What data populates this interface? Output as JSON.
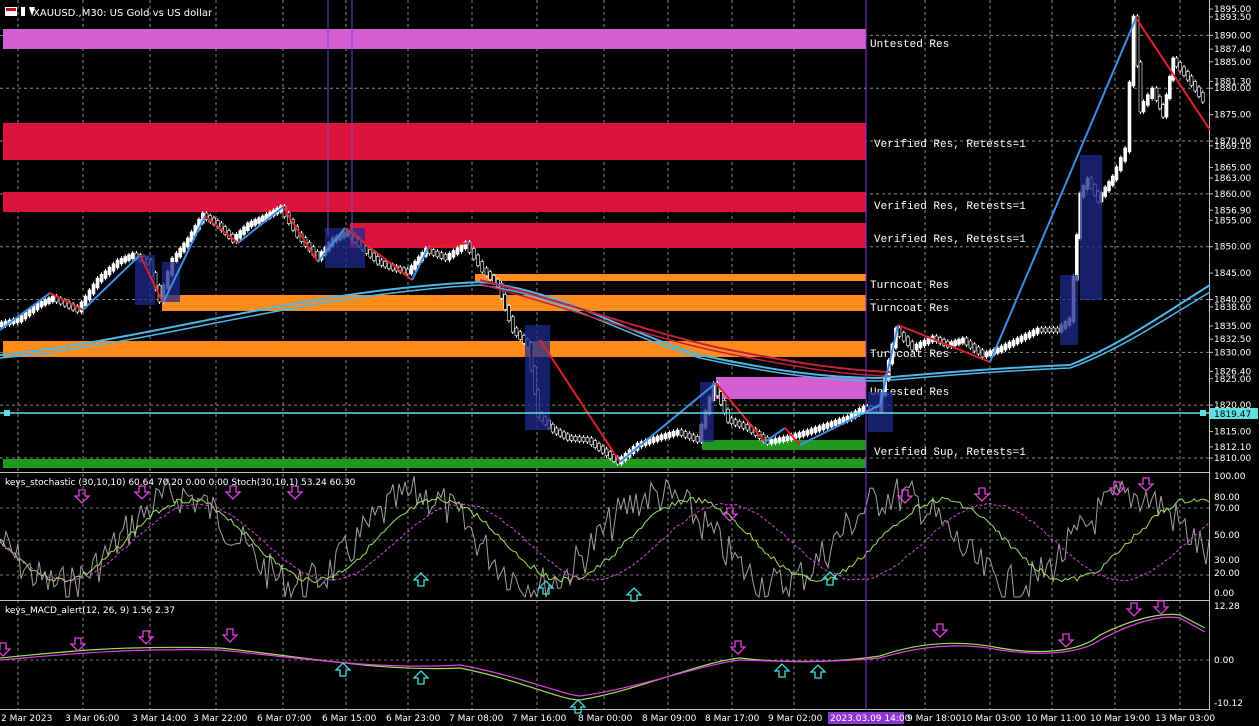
{
  "header": {
    "symbol_title": "XAUUSD.,M30:  US Gold vs US dollar",
    "stoch_title": "keys_stochastic (30,10,10) 60.64 70.20 0.00 0.00 Stoch(30,10,1) 53.24 60.30",
    "macd_title": "keys_MACD_alert(12, 26, 9) 1.56 2.37"
  },
  "colors": {
    "background": "#000000",
    "grid": "#c0c0c0",
    "bull_candle": "#ffffff",
    "untested_zone": "#d35fd3",
    "verified_res_zone": "#dc143c",
    "turncoat_zone": "#ff8c1a",
    "verified_sup_zone": "#1f9a1f",
    "moving_average_blue": "#4fb6e8",
    "moving_average_red": "#c2203f",
    "zigzag_blue": "#3a8fe8",
    "zigzag_red": "#e0202a",
    "signal_magenta": "#e040e0",
    "signal_cyan": "#40e0e0"
  },
  "price_axis": {
    "labels": [
      "1895.00",
      "1893.50",
      "1890.00",
      "1887.40",
      "1885.00",
      "1881.30",
      "1880.00",
      "1875.00",
      "1870.00",
      "1869.10",
      "1865.00",
      "1863.00",
      "1860.00",
      "1856.90",
      "1855.00",
      "1850.00",
      "1845.00",
      "1840.00",
      "1838.60",
      "1835.00",
      "1832.50",
      "1830.00",
      "1826.40",
      "1825.00",
      "1820.00",
      "1815.00",
      "1812.10",
      "1810.00"
    ],
    "current_price": "1819.47"
  },
  "zones": [
    {
      "label": "Untested Res",
      "kind": "untested"
    },
    {
      "label": "Verified Res, Retests=1",
      "kind": "verified_res"
    },
    {
      "label": "Verified Res, Retests=1",
      "kind": "verified_res"
    },
    {
      "label": "Verified Res, Retests=1",
      "kind": "verified_res"
    },
    {
      "label": "Turncoat Res",
      "kind": "turncoat"
    },
    {
      "label": "Turncoat Res",
      "kind": "turncoat"
    },
    {
      "label": "Turncoat Res",
      "kind": "turncoat"
    },
    {
      "label": "Untested Res",
      "kind": "untested"
    },
    {
      "label": "Verified Sup, Retests=1",
      "kind": "verified_sup"
    }
  ],
  "stoch_axis": {
    "labels": [
      "100.00",
      "80.00",
      "70.00",
      "50.00",
      "30.00",
      "20.00",
      "0.00"
    ]
  },
  "macd_axis": {
    "labels": [
      "12.28",
      "0.00",
      "-10.12"
    ]
  },
  "time_axis": {
    "labels": [
      "2 Mar 2023",
      "3 Mar 06:00",
      "3 Mar 14:00",
      "3 Mar 22:00",
      "6 Mar 07:00",
      "6 Mar 15:00",
      "6 Mar 23:00",
      "7 Mar 08:00",
      "7 Mar 16:00",
      "8 Mar 00:00",
      "8 Mar 09:00",
      "8 Mar 17:00",
      "9 Mar 02:00",
      "9 Mar 10:00",
      "9 Mar 18:00",
      "10 Mar 03:00",
      "10 Mar 11:00",
      "10 Mar 19:00",
      "13 Mar 03:00"
    ],
    "highlighted_label": "2023.03.09 14:00"
  }
}
